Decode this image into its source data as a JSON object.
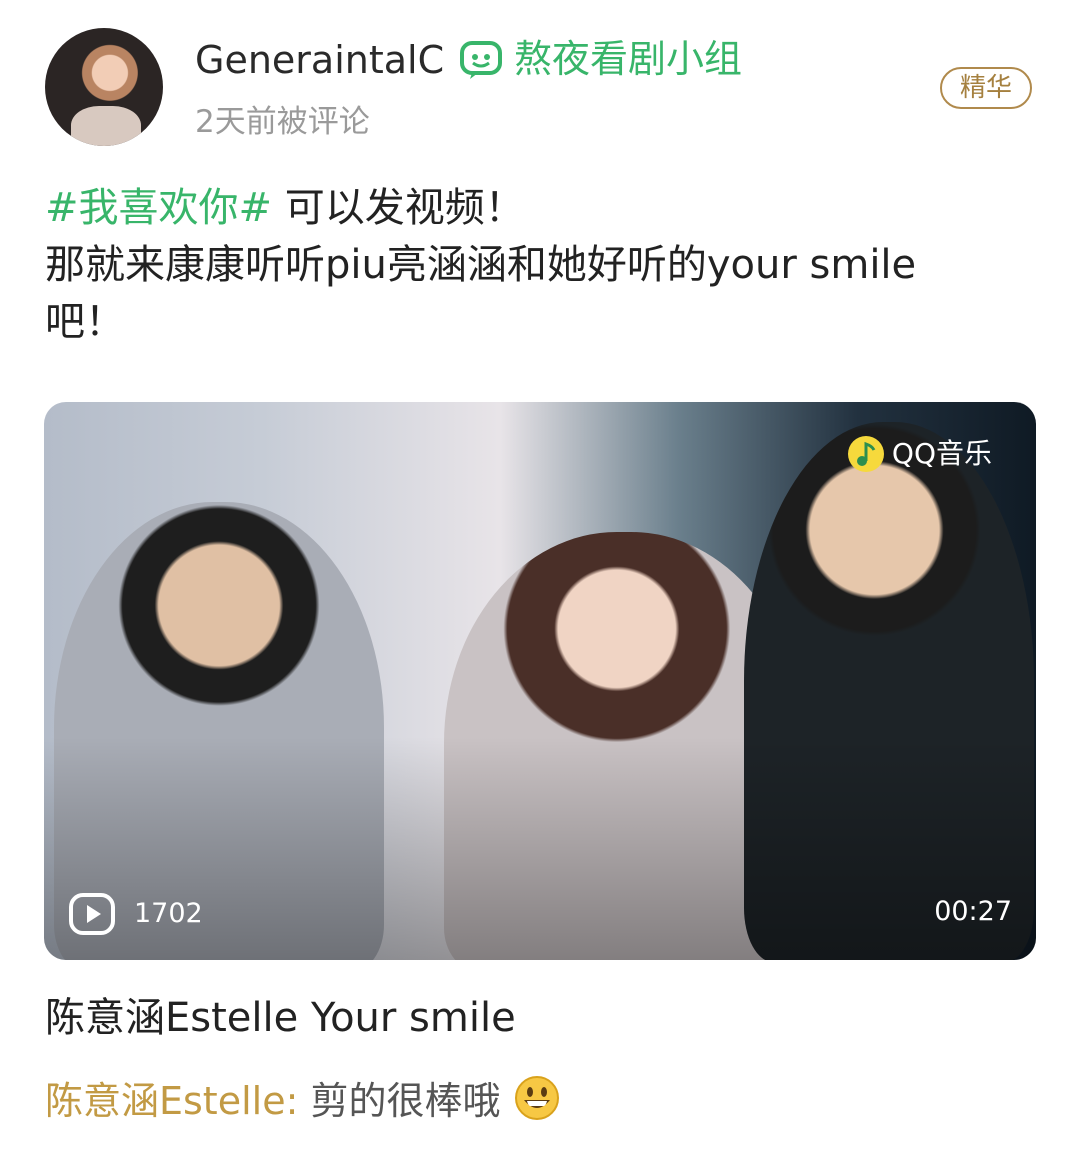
{
  "post": {
    "author": "GeneraintalC",
    "group": "熬夜看剧小组",
    "timestamp": "2天前被评论",
    "badge": "精华",
    "hashtag": "#我喜欢你#",
    "line1_rest": " 可以发视频！",
    "line2": "那就来康康听听piu亮涵涵和她好听的your smile",
    "line3": "吧！"
  },
  "video": {
    "watermark": "QQ音乐",
    "play_count": "1702",
    "duration": "00:27",
    "title": "陈意涵Estelle Your smile"
  },
  "comment": {
    "user": "陈意涵Estelle:",
    "text": " 剪的很棒哦",
    "emoji": "grinning-face-emoji"
  },
  "colors": {
    "accent_green": "#38b56a",
    "badge_gold": "#a5803f",
    "commenter_gold": "#c29a44"
  }
}
